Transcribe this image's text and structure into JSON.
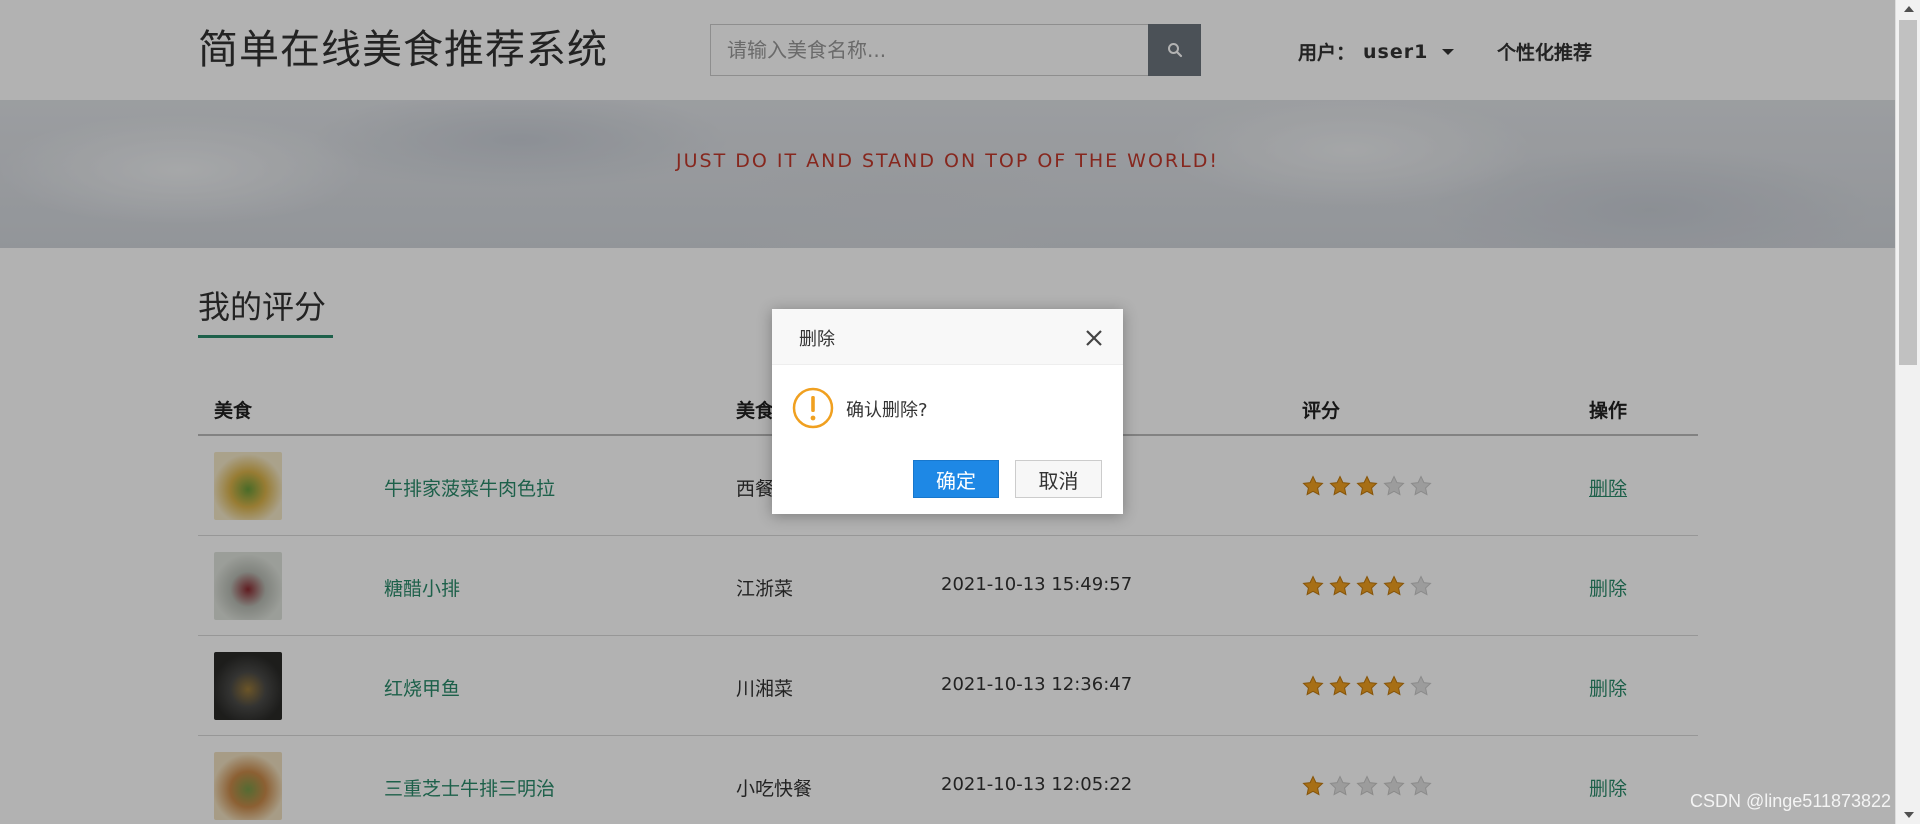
{
  "header": {
    "site_title": "简单在线美食推荐系统",
    "search_placeholder": "请输入美食名称...",
    "user_label": "用户：",
    "user_name": "user1",
    "personal_recommend": "个性化推荐"
  },
  "banner": {
    "text": "JUST DO IT AND STAND ON TOP OF THE WORLD!"
  },
  "section": {
    "title": "我的评分"
  },
  "table": {
    "headers": {
      "food": "美食",
      "category": "美食",
      "rating": "评分",
      "action": "操作"
    },
    "rows": [
      {
        "name": "牛排家菠菜牛肉色拉",
        "category": "西餐",
        "time": "",
        "rating": 3,
        "action": "删除",
        "thumb_colors": [
          "#d9b24a",
          "#6a9a3a",
          "#f4e8c8"
        ]
      },
      {
        "name": "糖醋小排",
        "category": "江浙菜",
        "time": "2021-10-13 15:49:57",
        "rating": 4,
        "action": "删除",
        "thumb_colors": [
          "#b8bcb4",
          "#8a2a30",
          "#dfe3dc"
        ]
      },
      {
        "name": "红烧甲鱼",
        "category": "川湘菜",
        "time": "2021-10-13 12:36:47",
        "rating": 4,
        "action": "删除",
        "thumb_colors": [
          "#4a4a48",
          "#9a7a3a",
          "#2a2a28"
        ]
      },
      {
        "name": "三重芝士牛排三明治",
        "category": "小吃快餐",
        "time": "2021-10-13 12:05:22",
        "rating": 1,
        "action": "删除",
        "thumb_colors": [
          "#c98a4a",
          "#7a9a4a",
          "#f0e0c0"
        ]
      }
    ],
    "max_rating": 5
  },
  "dialog": {
    "title": "删除",
    "message": "确认删除?",
    "ok_label": "确定",
    "cancel_label": "取消"
  },
  "watermark": "CSDN @linge511873822",
  "colors": {
    "accent_green": "#2a8a6a",
    "banner_text": "#c0392b",
    "primary_button": "#1e88e5",
    "warning_icon": "#f0a020",
    "star_filled": "#f0a020",
    "star_empty": "#e0e0e0"
  }
}
